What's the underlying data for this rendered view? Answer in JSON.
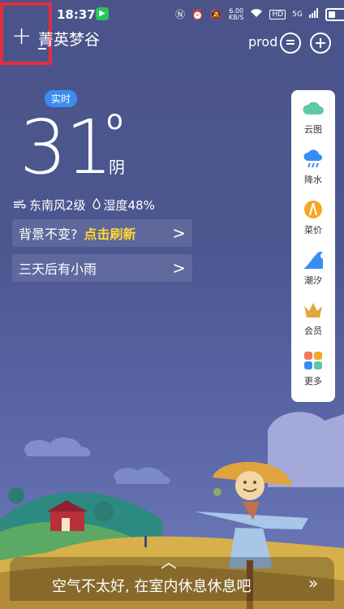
{
  "status_bar": {
    "time": "18:37",
    "net_speed_value": "6.00",
    "net_speed_unit": "KB/S",
    "hd": "HD",
    "signal": "5G"
  },
  "header": {
    "add": "+",
    "location": "菁英梦谷",
    "prod": "prod"
  },
  "weather": {
    "badge": "实时",
    "temperature": "31",
    "degree": "o",
    "condition": "阴",
    "wind": "东南风2级",
    "humidity": "湿度48%"
  },
  "cards": [
    {
      "text": "背景不变?",
      "action": "点击刷新",
      "arrow": ">"
    },
    {
      "text": "三天后有小雨",
      "arrow": ">"
    }
  ],
  "side_menu": [
    {
      "label": "云图",
      "icon": "cloud-icon"
    },
    {
      "label": "降水",
      "icon": "rain-icon"
    },
    {
      "label": "菜价",
      "icon": "vegetable-icon"
    },
    {
      "label": "潮汐",
      "icon": "wave-icon"
    },
    {
      "label": "会员",
      "icon": "crown-icon"
    },
    {
      "label": "更多",
      "icon": "grid-icon"
    }
  ],
  "bottom": {
    "tip": "空气不太好, 在室内休息休息吧",
    "arrow": "»",
    "chevron": "︿"
  },
  "colors": {
    "accent_blue": "#3a8df0",
    "refresh_yellow": "#ffd92e",
    "highlight_red": "#e22e3f"
  }
}
